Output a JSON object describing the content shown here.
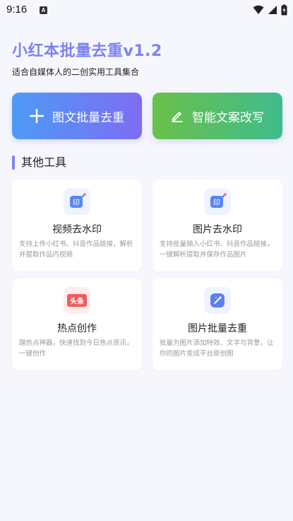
{
  "status_bar": {
    "time": "9:16",
    "notification_letter": "A"
  },
  "header": {
    "title": "小红本批量去重v1.2",
    "subtitle": "适合自媒体人的二创实用工具集合"
  },
  "actions": {
    "batch_dedupe": {
      "label": "图文批量去重",
      "icon": "plus-icon"
    },
    "smart_copy": {
      "label": "智能文案改写",
      "icon": "edit-icon"
    }
  },
  "section": {
    "title": "其他工具"
  },
  "tools": [
    {
      "title": "视频去水印",
      "desc": "支持上传小红书、抖音作品链接，解析并提取作品内视频",
      "icon": "stamp-icon",
      "badge": "印"
    },
    {
      "title": "图片去水印",
      "desc": "支持批量输入小红书、抖音作品链接，一键解析提取并保存作品图片",
      "icon": "stamp-icon",
      "badge": "印"
    },
    {
      "title": "热点创作",
      "desc": "蹭热点神器，快速找到今日热点资讯，一键创作",
      "icon": "toutiao-icon",
      "badge": "头条"
    },
    {
      "title": "图片批量去重",
      "desc": "批量为图片添加特效、文字与背景，让你的图片变成平台原创图",
      "icon": "magic-wand-icon"
    }
  ],
  "colors": {
    "accent": "#7c83f2",
    "blue_gradient_start": "#4c9bf6",
    "blue_gradient_end": "#7f6cf3",
    "green_gradient_start": "#6ac04a",
    "green_gradient_end": "#3fbc8c",
    "background": "#f6f7fd"
  }
}
